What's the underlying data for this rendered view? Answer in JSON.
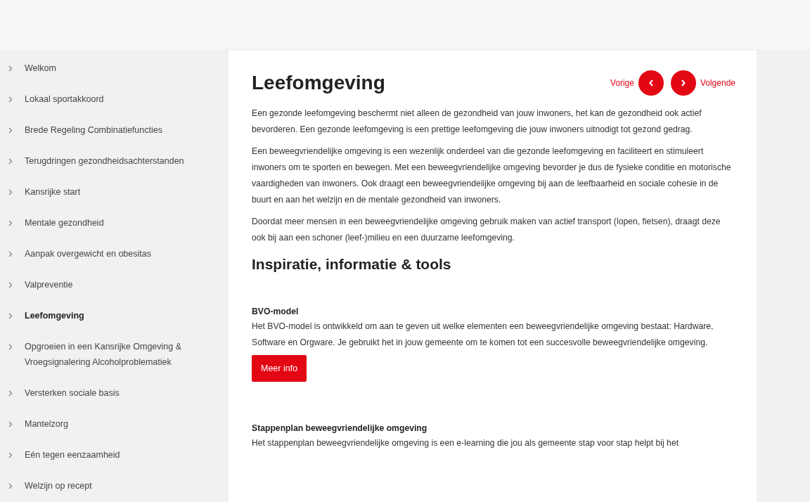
{
  "sidebar": {
    "items": [
      {
        "label": "Welkom",
        "selected": false
      },
      {
        "label": "Lokaal sportakkoord",
        "selected": false
      },
      {
        "label": "Brede Regeling Combinatiefuncties",
        "selected": false
      },
      {
        "label": "Terugdringen gezondheidsachterstanden",
        "selected": false
      },
      {
        "label": "Kansrijke start",
        "selected": false
      },
      {
        "label": "Mentale gezondheid",
        "selected": false
      },
      {
        "label": "Aanpak overgewicht en obesitas",
        "selected": false
      },
      {
        "label": "Valpreventie",
        "selected": false
      },
      {
        "label": "Leefomgeving",
        "selected": true
      },
      {
        "label": "Opgroeien in een Kansrijke Omgeving & Vroegsignalering Alcoholproblematiek",
        "selected": false
      },
      {
        "label": "Versterken sociale basis",
        "selected": false
      },
      {
        "label": "Mantelzorg",
        "selected": false
      },
      {
        "label": "Eén tegen eenzaamheid",
        "selected": false
      },
      {
        "label": "Welzijn op recept",
        "selected": false
      }
    ]
  },
  "content": {
    "title": "Leefomgeving",
    "pager": {
      "previous": "Vorige",
      "next": "Volgende"
    },
    "paragraphs": [
      "Een gezonde leefomgeving beschermt niet alleen de gezondheid van jouw inwoners, het kan de gezondheid ook actief bevorderen. Een gezonde leefomgeving is een prettige leefomgeving die jouw inwoners uitnodigt tot gezond gedrag.",
      "Een beweegvriendelijke omgeving is een wezenlijk onderdeel van die gezonde leefomgeving en faciliteert en stimuleert inwoners om te sporten en bewegen. Met een beweegvriendelijke omgeving bevorder je dus de fysieke conditie en motorische vaardigheden van inwoners. Ook draagt een beweegvriendelijke omgeving bij aan de leefbaarheid en sociale cohesie in de buurt en aan het welzijn en de mentale gezondheid van inwoners.",
      "Doordat meer mensen in een beweegvriendelijke omgeving gebruik maken van actief transport (lopen, fietsen), draagt deze ook bij aan een schoner (leef-)milieu en een duurzame leefomgeving."
    ],
    "section_title": "Inspiratie, informatie & tools",
    "resources": [
      {
        "title": "BVO-model",
        "description": "Het BVO-model is ontwikkeld om aan te geven uit welke elementen een beweegvriendelijke omgeving bestaat: Hardware, Software en Orgware. Je gebruikt het in jouw gemeente om te komen tot een succesvolle beweegvriendelijke omgeving.",
        "button": "Meer info"
      },
      {
        "title": "Stappenplan beweegvriendelijke omgeving",
        "description": "Het stappenplan beweegvriendelijke omgeving is een e-learning die jou als gemeente stap voor stap helpt bij het"
      }
    ]
  }
}
